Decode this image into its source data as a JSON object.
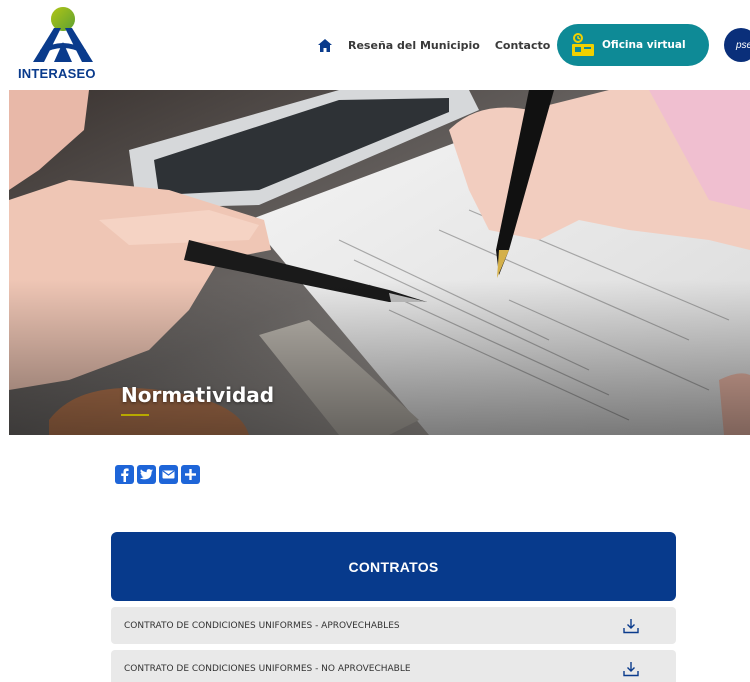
{
  "brand": {
    "name": "INTERASEO"
  },
  "nav": {
    "home_icon": "home-icon",
    "links": [
      "Reseña del Municipio",
      "Contacto"
    ],
    "cta_label": "Oficina virtual",
    "pse_label": "pse"
  },
  "hero": {
    "title": "Normatividad"
  },
  "share": {
    "icons": [
      "facebook-icon",
      "twitter-icon",
      "email-icon",
      "plus-icon"
    ]
  },
  "contratos": {
    "heading": "CONTRATOS",
    "rows": [
      "CONTRATO DE CONDICIONES UNIFORMES - APROVECHABLES",
      "CONTRATO DE CONDICIONES UNIFORMES - NO APROVECHABLE"
    ]
  },
  "colors": {
    "primary": "#073a8c",
    "teal": "#0e8a96",
    "accent": "#b7a800",
    "share": "#1e65d8"
  }
}
